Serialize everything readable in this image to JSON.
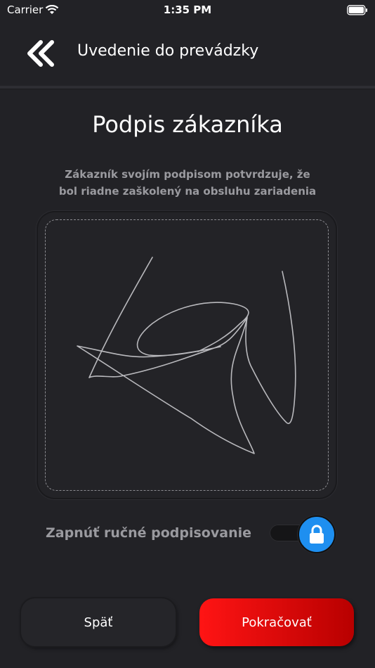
{
  "status_bar": {
    "carrier": "Carrier",
    "time": "1:35 PM"
  },
  "nav": {
    "title": "Uvedenie do prevádzky"
  },
  "main": {
    "title": "Podpis zákazníka",
    "subtitle_line1": "Zákazník svojím podpisom potvrdzuje, že",
    "subtitle_line2": "bol riadne zaškolený na obsluhu zariadenia"
  },
  "toggle": {
    "label": "Zapnúť ručné podpisovanie",
    "state": "locked"
  },
  "buttons": {
    "back_label": "Späť",
    "next_label": "Pokračovať"
  },
  "colors": {
    "background": "#222226",
    "accent_blue": "#1e8ff0",
    "primary_red": "#ff1414"
  }
}
